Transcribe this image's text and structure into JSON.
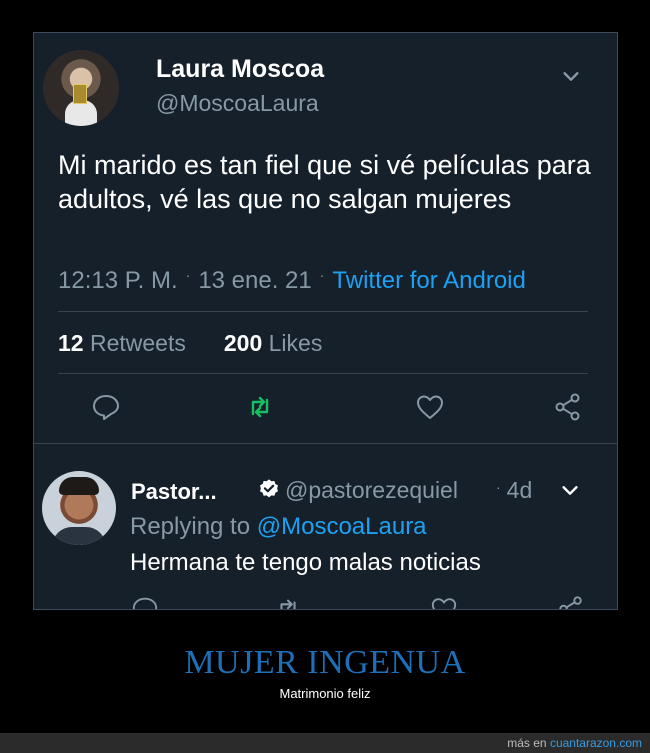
{
  "tweet": {
    "author_name": "Laura Moscoa",
    "author_handle": "@MoscoaLaura",
    "text": "Mi marido es tan fiel que si vé películas para adultos, vé las que no salgan mujeres",
    "time": "12:13 P. M.",
    "date": "13 ene. 21",
    "source": "Twitter for Android",
    "retweets_count": "12",
    "retweets_label": "Retweets",
    "likes_count": "200",
    "likes_label": "Likes"
  },
  "reply": {
    "author_name": "Pastor...",
    "author_handle": "@pastorezequiel",
    "time": "4d",
    "replying_prefix": "Replying to",
    "replying_handle": "@MoscoaLaura",
    "text": "Hermana te tengo malas noticias"
  },
  "caption": {
    "title": "MUJER INGENUA",
    "subtitle": "Matrimonio feliz"
  },
  "footer": {
    "prefix": "más en",
    "site": "cuantarazon.com"
  },
  "colors": {
    "background": "#15202b",
    "accent": "#1da1f2",
    "muted": "#8899a6",
    "retweet_active": "#17bf63",
    "caption": "#1d6fb8"
  },
  "icons": [
    "chevron-down-icon",
    "reply-icon",
    "retweet-icon",
    "like-icon",
    "share-icon",
    "verified-icon"
  ]
}
